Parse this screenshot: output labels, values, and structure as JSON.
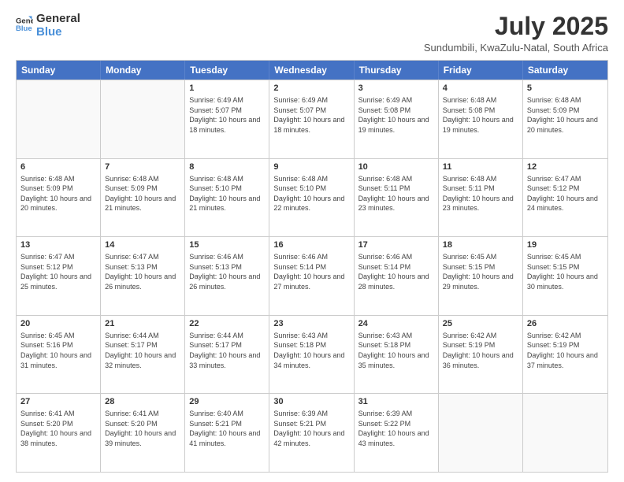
{
  "logo": {
    "general": "General",
    "blue": "Blue"
  },
  "header": {
    "month": "July 2025",
    "location": "Sundumbili, KwaZulu-Natal, South Africa"
  },
  "days": [
    "Sunday",
    "Monday",
    "Tuesday",
    "Wednesday",
    "Thursday",
    "Friday",
    "Saturday"
  ],
  "weeks": [
    [
      {
        "day": "",
        "info": ""
      },
      {
        "day": "",
        "info": ""
      },
      {
        "day": "1",
        "info": "Sunrise: 6:49 AM\nSunset: 5:07 PM\nDaylight: 10 hours and 18 minutes."
      },
      {
        "day": "2",
        "info": "Sunrise: 6:49 AM\nSunset: 5:07 PM\nDaylight: 10 hours and 18 minutes."
      },
      {
        "day": "3",
        "info": "Sunrise: 6:49 AM\nSunset: 5:08 PM\nDaylight: 10 hours and 19 minutes."
      },
      {
        "day": "4",
        "info": "Sunrise: 6:48 AM\nSunset: 5:08 PM\nDaylight: 10 hours and 19 minutes."
      },
      {
        "day": "5",
        "info": "Sunrise: 6:48 AM\nSunset: 5:09 PM\nDaylight: 10 hours and 20 minutes."
      }
    ],
    [
      {
        "day": "6",
        "info": "Sunrise: 6:48 AM\nSunset: 5:09 PM\nDaylight: 10 hours and 20 minutes."
      },
      {
        "day": "7",
        "info": "Sunrise: 6:48 AM\nSunset: 5:09 PM\nDaylight: 10 hours and 21 minutes."
      },
      {
        "day": "8",
        "info": "Sunrise: 6:48 AM\nSunset: 5:10 PM\nDaylight: 10 hours and 21 minutes."
      },
      {
        "day": "9",
        "info": "Sunrise: 6:48 AM\nSunset: 5:10 PM\nDaylight: 10 hours and 22 minutes."
      },
      {
        "day": "10",
        "info": "Sunrise: 6:48 AM\nSunset: 5:11 PM\nDaylight: 10 hours and 23 minutes."
      },
      {
        "day": "11",
        "info": "Sunrise: 6:48 AM\nSunset: 5:11 PM\nDaylight: 10 hours and 23 minutes."
      },
      {
        "day": "12",
        "info": "Sunrise: 6:47 AM\nSunset: 5:12 PM\nDaylight: 10 hours and 24 minutes."
      }
    ],
    [
      {
        "day": "13",
        "info": "Sunrise: 6:47 AM\nSunset: 5:12 PM\nDaylight: 10 hours and 25 minutes."
      },
      {
        "day": "14",
        "info": "Sunrise: 6:47 AM\nSunset: 5:13 PM\nDaylight: 10 hours and 26 minutes."
      },
      {
        "day": "15",
        "info": "Sunrise: 6:46 AM\nSunset: 5:13 PM\nDaylight: 10 hours and 26 minutes."
      },
      {
        "day": "16",
        "info": "Sunrise: 6:46 AM\nSunset: 5:14 PM\nDaylight: 10 hours and 27 minutes."
      },
      {
        "day": "17",
        "info": "Sunrise: 6:46 AM\nSunset: 5:14 PM\nDaylight: 10 hours and 28 minutes."
      },
      {
        "day": "18",
        "info": "Sunrise: 6:45 AM\nSunset: 5:15 PM\nDaylight: 10 hours and 29 minutes."
      },
      {
        "day": "19",
        "info": "Sunrise: 6:45 AM\nSunset: 5:15 PM\nDaylight: 10 hours and 30 minutes."
      }
    ],
    [
      {
        "day": "20",
        "info": "Sunrise: 6:45 AM\nSunset: 5:16 PM\nDaylight: 10 hours and 31 minutes."
      },
      {
        "day": "21",
        "info": "Sunrise: 6:44 AM\nSunset: 5:17 PM\nDaylight: 10 hours and 32 minutes."
      },
      {
        "day": "22",
        "info": "Sunrise: 6:44 AM\nSunset: 5:17 PM\nDaylight: 10 hours and 33 minutes."
      },
      {
        "day": "23",
        "info": "Sunrise: 6:43 AM\nSunset: 5:18 PM\nDaylight: 10 hours and 34 minutes."
      },
      {
        "day": "24",
        "info": "Sunrise: 6:43 AM\nSunset: 5:18 PM\nDaylight: 10 hours and 35 minutes."
      },
      {
        "day": "25",
        "info": "Sunrise: 6:42 AM\nSunset: 5:19 PM\nDaylight: 10 hours and 36 minutes."
      },
      {
        "day": "26",
        "info": "Sunrise: 6:42 AM\nSunset: 5:19 PM\nDaylight: 10 hours and 37 minutes."
      }
    ],
    [
      {
        "day": "27",
        "info": "Sunrise: 6:41 AM\nSunset: 5:20 PM\nDaylight: 10 hours and 38 minutes."
      },
      {
        "day": "28",
        "info": "Sunrise: 6:41 AM\nSunset: 5:20 PM\nDaylight: 10 hours and 39 minutes."
      },
      {
        "day": "29",
        "info": "Sunrise: 6:40 AM\nSunset: 5:21 PM\nDaylight: 10 hours and 41 minutes."
      },
      {
        "day": "30",
        "info": "Sunrise: 6:39 AM\nSunset: 5:21 PM\nDaylight: 10 hours and 42 minutes."
      },
      {
        "day": "31",
        "info": "Sunrise: 6:39 AM\nSunset: 5:22 PM\nDaylight: 10 hours and 43 minutes."
      },
      {
        "day": "",
        "info": ""
      },
      {
        "day": "",
        "info": ""
      }
    ]
  ]
}
